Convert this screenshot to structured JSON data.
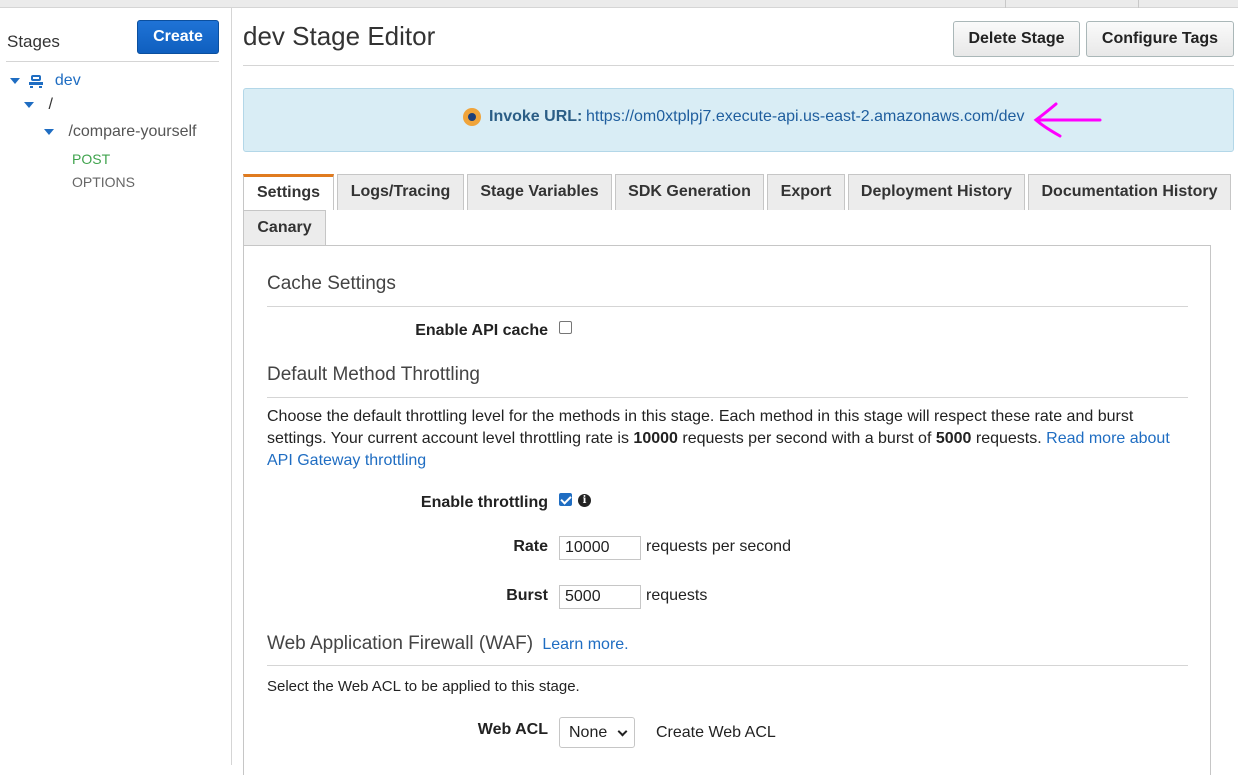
{
  "sidebar": {
    "title": "Stages",
    "create_label": "Create",
    "tree": {
      "stage": "dev",
      "root": "/",
      "resource": "/compare-yourself",
      "methods": [
        "POST",
        "OPTIONS"
      ]
    }
  },
  "header": {
    "title": "dev Stage Editor",
    "delete_label": "Delete Stage",
    "tags_label": "Configure Tags"
  },
  "invoke": {
    "label": "Invoke URL:",
    "url": "https://om0xtplpj7.execute-api.us-east-2.amazonaws.com/dev"
  },
  "tabs": [
    {
      "label": "Settings",
      "active": true
    },
    {
      "label": "Logs/Tracing"
    },
    {
      "label": "Stage Variables"
    },
    {
      "label": "SDK Generation"
    },
    {
      "label": "Export"
    },
    {
      "label": "Deployment History"
    },
    {
      "label": "Documentation History"
    },
    {
      "label": "Canary"
    }
  ],
  "cache": {
    "title": "Cache Settings",
    "enable_label": "Enable API cache",
    "enabled": false
  },
  "throttling": {
    "title": "Default Method Throttling",
    "desc_1": "Choose the default throttling level for the methods in this stage. Each method in this stage will respect these rate and burst settings. Your current account level throttling rate is ",
    "rate_limit": "10000",
    "desc_2": " requests per second with a burst of ",
    "burst_limit": "5000",
    "desc_3": " requests. ",
    "link": "Read more about API Gateway throttling",
    "enable_label": "Enable throttling",
    "enabled": true,
    "info_glyph": "i",
    "rate_label": "Rate",
    "rate_value": "10000",
    "rate_unit": "requests per second",
    "burst_label": "Burst",
    "burst_value": "5000",
    "burst_unit": "requests"
  },
  "waf": {
    "title": "Web Application Firewall (WAF)",
    "learn_more": "Learn more.",
    "desc": "Select the Web ACL to be applied to this stage.",
    "acl_label": "Web ACL",
    "acl_value": "None",
    "create_link": "Create Web ACL"
  },
  "colors": {
    "primary_button": "#1f73d6",
    "link": "#1f6dc2",
    "invoke_bg": "#d9edf5",
    "active_tab_accent": "#e07b1f",
    "post_method": "#3fa34d",
    "annotation_arrow": "#ff00ff"
  },
  "icons": [
    "stage-icon",
    "status-dot-icon",
    "annotation-arrow-icon",
    "info-icon",
    "chevron-down-icon"
  ]
}
